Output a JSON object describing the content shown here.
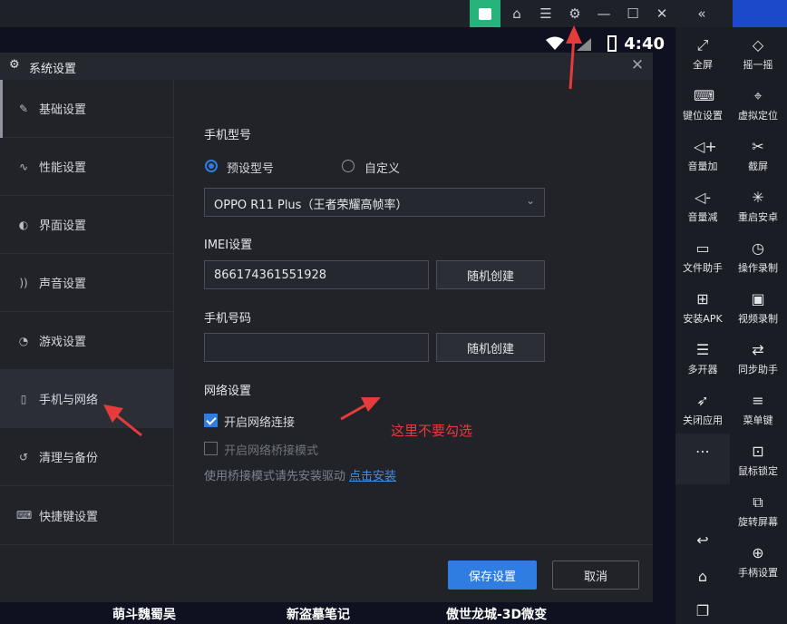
{
  "dialog": {
    "title": "系统设置",
    "nav": [
      {
        "label": "基础设置",
        "icon": "edit-icon"
      },
      {
        "label": "性能设置",
        "icon": "pulse-icon"
      },
      {
        "label": "界面设置",
        "icon": "palette-icon"
      },
      {
        "label": "声音设置",
        "icon": "sound-icon"
      },
      {
        "label": "游戏设置",
        "icon": "gauge-icon"
      },
      {
        "label": "手机与网络",
        "icon": "phone-wifi-icon"
      },
      {
        "label": "清理与备份",
        "icon": "history-icon"
      },
      {
        "label": "快捷键设置",
        "icon": "keyboard-icon"
      }
    ],
    "active_nav": "手机与网络",
    "phone_model": {
      "title": "手机型号",
      "option_preset": "预设型号",
      "option_custom": "自定义",
      "selected": "预设型号",
      "select_value": "OPPO R11 Plus（王者荣耀高帧率）"
    },
    "imei": {
      "title": "IMEI设置",
      "value": "866174361551928",
      "button": "随机创建"
    },
    "phone_number": {
      "title": "手机号码",
      "value": "",
      "button": "随机创建"
    },
    "network": {
      "title": "网络设置",
      "enable_label": "开启网络连接",
      "enable_checked": true,
      "bridge_label": "开启网络桥接模式",
      "bridge_checked": false,
      "hint": "使用桥接模式请先安装驱动",
      "hint_link": "点击安装"
    },
    "annotation": "这里不要勾选",
    "save_button": "保存设置",
    "cancel_button": "取消"
  },
  "status_bar": {
    "time": "4:40"
  },
  "sidebar": {
    "col1": [
      {
        "label": "全屏",
        "icon": "fullscreen-icon"
      },
      {
        "label": "键位设置",
        "icon": "keyboard-icon"
      },
      {
        "label": "音量加",
        "icon": "volume-up-icon"
      },
      {
        "label": "音量减",
        "icon": "volume-down-icon"
      },
      {
        "label": "文件助手",
        "icon": "monitor-icon"
      },
      {
        "label": "安装APK",
        "icon": "apk-icon"
      },
      {
        "label": "多开器",
        "icon": "stack-icon"
      },
      {
        "label": "关闭应用",
        "icon": "rocket-icon"
      },
      {
        "label": "",
        "icon": "more-icon"
      }
    ],
    "col2": [
      {
        "label": "摇一摇",
        "icon": "shake-icon"
      },
      {
        "label": "虚拟定位",
        "icon": "location-icon"
      },
      {
        "label": "截屏",
        "icon": "scissors-icon"
      },
      {
        "label": "重启安卓",
        "icon": "restart-icon"
      },
      {
        "label": "操作录制",
        "icon": "record-icon"
      },
      {
        "label": "视频录制",
        "icon": "video-record-icon"
      },
      {
        "label": "同步助手",
        "icon": "sync-icon"
      },
      {
        "label": "菜单键",
        "icon": "menu-icon"
      },
      {
        "label": "鼠标锁定",
        "icon": "mouse-lock-icon"
      },
      {
        "label": "旋转屏幕",
        "icon": "rotate-icon"
      },
      {
        "label": "手柄设置",
        "icon": "gamepad-icon"
      }
    ]
  },
  "bottom_apps": [
    "萌斗魏蜀吴",
    "新盗墓笔记",
    "傲世龙城-3D微变"
  ]
}
